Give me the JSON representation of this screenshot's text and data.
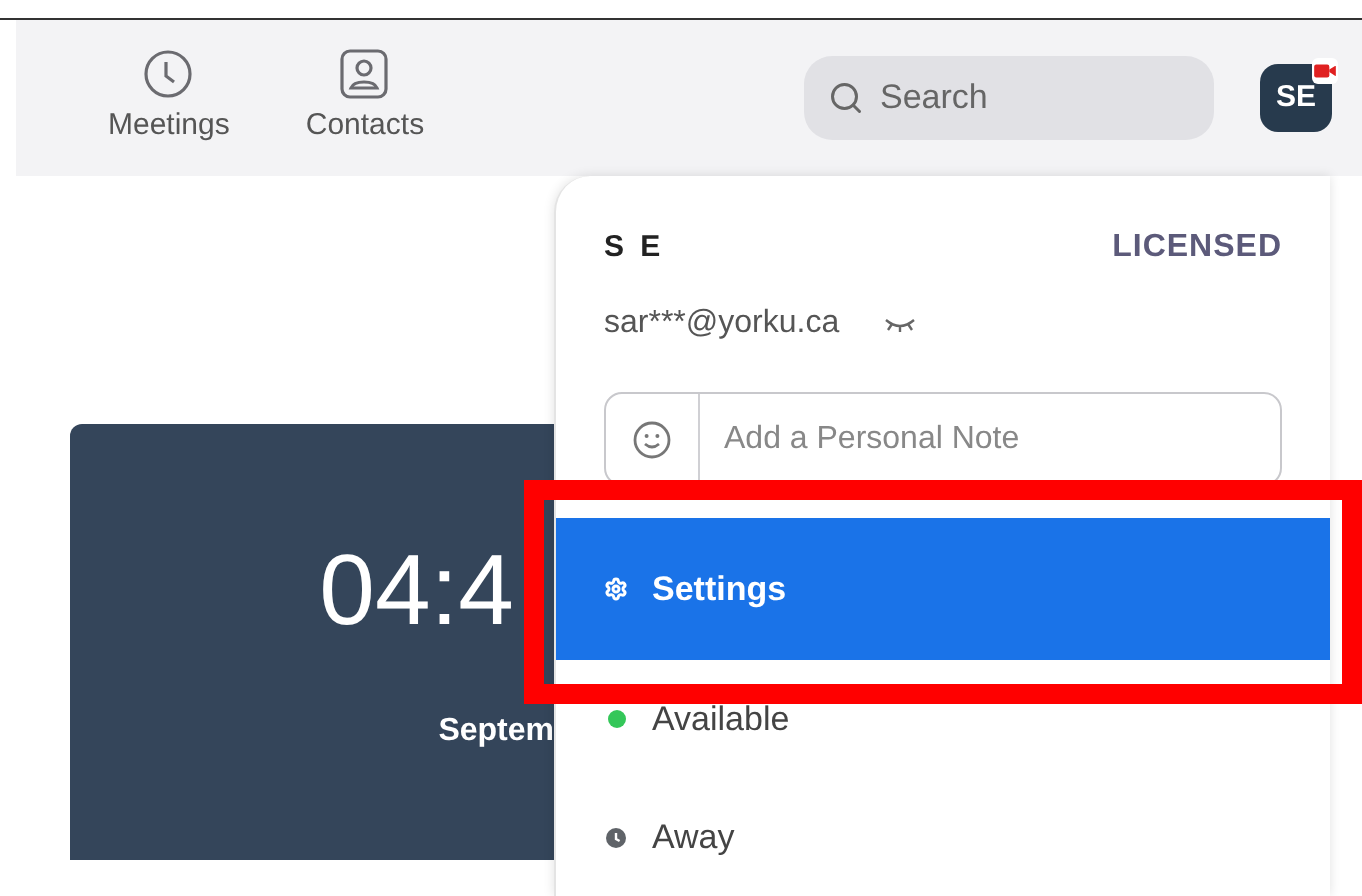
{
  "nav": [
    {
      "label": "Meetings",
      "kind": "clock"
    },
    {
      "label": "Contacts",
      "kind": "contact"
    }
  ],
  "search": {
    "placeholder": "Search"
  },
  "avatar": {
    "initials": "SE",
    "camera_badge": true
  },
  "meeting_card": {
    "time": "04:4",
    "date": "Septem"
  },
  "profile_menu": {
    "name": "S E",
    "license": "LICENSED",
    "email": "sar***@yorku.ca",
    "note": {
      "placeholder": "Add a Personal Note"
    },
    "items": [
      {
        "kind": "menu",
        "label": "Settings",
        "selected": true
      },
      {
        "kind": "dot",
        "label": "Available",
        "color": "#34c759",
        "selected": false
      },
      {
        "kind": "clock",
        "label": "Away",
        "color": "#5f6368",
        "selected": false
      }
    ]
  },
  "highlight_frame": true
}
